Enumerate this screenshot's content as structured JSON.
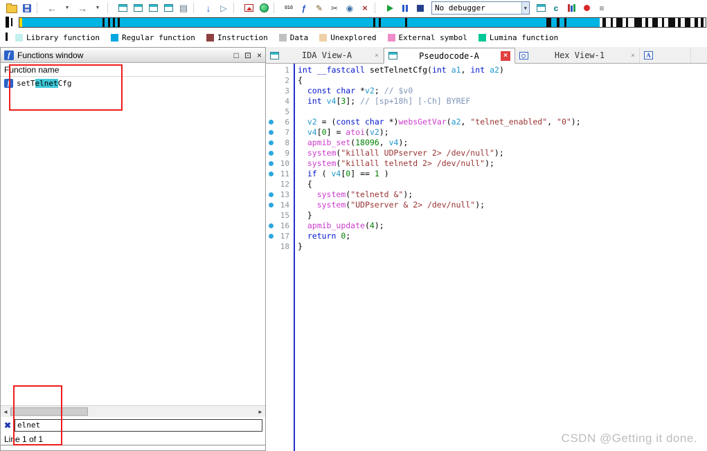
{
  "app": {
    "watermark": "CSDN @Getting it done."
  },
  "toolbar": {
    "debugger_combo": "No debugger",
    "items": [
      {
        "name": "open-file-icon",
        "kind": "folder"
      },
      {
        "name": "save-file-icon",
        "kind": "floppy"
      },
      {
        "name": "separator",
        "kind": "sep"
      },
      {
        "name": "navigate-back-icon",
        "kind": "glyph",
        "glyph": "←",
        "fg": "#6e6e6e",
        "size": 14,
        "bold": true
      },
      {
        "name": "back-history-dropdown-icon",
        "kind": "glyph",
        "glyph": "▼",
        "fg": "#505050",
        "size": 7
      },
      {
        "name": "navigate-forward-icon",
        "kind": "glyph",
        "glyph": "→",
        "fg": "#6e6e6e",
        "size": 14,
        "bold": true
      },
      {
        "name": "forward-history-dropdown-icon",
        "kind": "glyph",
        "glyph": "▼",
        "fg": "#505050",
        "size": 7
      },
      {
        "name": "separator",
        "kind": "sep"
      },
      {
        "name": "open-ida-view-icon",
        "kind": "win"
      },
      {
        "name": "open-hex-view-icon",
        "kind": "win"
      },
      {
        "name": "open-structures-icon",
        "kind": "win"
      },
      {
        "name": "open-enums-icon",
        "kind": "win"
      },
      {
        "name": "print-icon",
        "kind": "glyph",
        "glyph": "▤",
        "fg": "#5f7585",
        "size": 13
      },
      {
        "name": "separator",
        "kind": "sep"
      },
      {
        "name": "jump-address-icon",
        "kind": "glyph",
        "glyph": "↓",
        "fg": "#1d5fd6",
        "size": 14,
        "bold": true
      },
      {
        "name": "run-plugin-icon",
        "kind": "glyph",
        "glyph": "▷",
        "fg": "#4a7d9a",
        "size": 12
      },
      {
        "name": "separator",
        "kind": "sep"
      },
      {
        "name": "flow-chart-icon",
        "kind": "image"
      },
      {
        "name": "lumina-icon",
        "kind": "lumina"
      },
      {
        "name": "separator",
        "kind": "sep"
      },
      {
        "name": "binary-data-icon",
        "kind": "glyph",
        "glyph": "010",
        "fg": "#404040",
        "size": 7,
        "bold": true
      },
      {
        "name": "create-function-icon",
        "kind": "glyph",
        "glyph": "ƒ",
        "fg": "#2050c0",
        "size": 12,
        "bold": true
      },
      {
        "name": "edit-comment-icon",
        "kind": "glyph",
        "glyph": "✎",
        "fg": "#806030",
        "size": 12
      },
      {
        "name": "cut-patch-icon",
        "kind": "glyph",
        "glyph": "✂",
        "fg": "#505050",
        "size": 12
      },
      {
        "name": "snapshot-icon",
        "kind": "glyph",
        "glyph": "◉",
        "fg": "#3a6ea5",
        "size": 12
      },
      {
        "name": "delete-function-icon",
        "kind": "glyph",
        "glyph": "×",
        "fg": "#a03030",
        "size": 13,
        "bold": true
      },
      {
        "name": "separator",
        "kind": "sep"
      },
      {
        "name": "start-process-icon",
        "kind": "play"
      },
      {
        "name": "pause-process-icon",
        "kind": "pause"
      },
      {
        "name": "stop-process-icon",
        "kind": "stop"
      },
      {
        "name": "debugger-selector",
        "kind": "combo"
      },
      {
        "name": "attach-process-icon",
        "kind": "win"
      },
      {
        "name": "run-to-cursor-icon",
        "kind": "glyph",
        "glyph": "c",
        "fg": "#00787f",
        "size": 12,
        "bold": true
      },
      {
        "name": "open-libraries-icon",
        "kind": "books"
      },
      {
        "name": "breakpoint-icon",
        "kind": "bpt"
      },
      {
        "name": "debugger-options-icon",
        "kind": "glyph",
        "glyph": "≡",
        "fg": "#585858",
        "size": 12,
        "bold": true
      }
    ]
  },
  "navband": {
    "base_color": "#00b4e4",
    "segments": [
      {
        "pos": 0,
        "w": 0.45,
        "color": "#ffd800"
      },
      {
        "pos": 12.1,
        "w": 0.35,
        "color": "#101010"
      },
      {
        "pos": 12.9,
        "w": 0.35,
        "color": "#101010"
      },
      {
        "pos": 13.6,
        "w": 0.3,
        "color": "#101010"
      },
      {
        "pos": 14.3,
        "w": 0.3,
        "color": "#101010"
      },
      {
        "pos": 51.6,
        "w": 0.3,
        "color": "#101010"
      },
      {
        "pos": 52.4,
        "w": 0.3,
        "color": "#101010"
      },
      {
        "pos": 56.2,
        "w": 0.3,
        "color": "#101010"
      },
      {
        "pos": 76.8,
        "w": 0.7,
        "color": "#101010"
      },
      {
        "pos": 78.3,
        "w": 0.4,
        "color": "#101010"
      },
      {
        "pos": 79.4,
        "w": 0.3,
        "color": "#101010"
      },
      {
        "pos": 84.6,
        "w": 15.4,
        "color": "#f8f8f8"
      },
      {
        "pos": 85.0,
        "w": 0.5,
        "color": "#101010"
      },
      {
        "pos": 86.2,
        "w": 0.3,
        "color": "#101010"
      },
      {
        "pos": 87.0,
        "w": 0.9,
        "color": "#101010"
      },
      {
        "pos": 88.4,
        "w": 0.35,
        "color": "#101010"
      },
      {
        "pos": 89.6,
        "w": 1.1,
        "color": "#101010"
      },
      {
        "pos": 91.2,
        "w": 0.4,
        "color": "#101010"
      },
      {
        "pos": 92.2,
        "w": 0.8,
        "color": "#101010"
      },
      {
        "pos": 93.6,
        "w": 0.35,
        "color": "#101010"
      },
      {
        "pos": 94.6,
        "w": 1.0,
        "color": "#101010"
      },
      {
        "pos": 96.0,
        "w": 0.4,
        "color": "#101010"
      },
      {
        "pos": 97.0,
        "w": 0.8,
        "color": "#101010"
      },
      {
        "pos": 98.4,
        "w": 0.5,
        "color": "#101010"
      },
      {
        "pos": 99.3,
        "w": 0.4,
        "color": "#101010"
      }
    ]
  },
  "legend": {
    "items": [
      {
        "label": "Library function",
        "color": "#c4f0ee"
      },
      {
        "label": "Regular function",
        "color": "#00a8e0"
      },
      {
        "label": "Instruction",
        "color": "#8e4040"
      },
      {
        "label": "Data",
        "color": "#c0c0c0"
      },
      {
        "label": "Unexplored",
        "color": "#f0d0a8"
      },
      {
        "label": "External symbol",
        "color": "#f08cc8"
      },
      {
        "label": "Lumina function",
        "color": "#00c896"
      }
    ]
  },
  "functions_panel": {
    "title": "Functions window",
    "column_header": "Function name",
    "highlight_color": "#3fc8d8",
    "rows": [
      {
        "name_segments": [
          {
            "t": "setT"
          },
          {
            "t": "elnet",
            "hl": true
          },
          {
            "t": "Cfg"
          }
        ]
      }
    ],
    "search_value": "elnet",
    "status": "Line 1 of 1"
  },
  "tab_bar": {
    "tabs": [
      {
        "name": "tab-ida-view-a",
        "label": "IDA View-A",
        "icon": "ida-view-icon",
        "kind": "win",
        "active": false,
        "close": "gray"
      },
      {
        "name": "tab-pseudocode-a",
        "label": "Pseudocode-A",
        "icon": "pseudocode-icon",
        "kind": "win",
        "active": true,
        "close": "red"
      },
      {
        "name": "tab-hex-view-1",
        "label": "Hex View-1",
        "icon": "hex-view-icon",
        "kind": "hexwin",
        "active": false,
        "close": "gray"
      },
      {
        "name": "tab-strings",
        "label": "",
        "icon": "strings-view-icon",
        "kind": "awin",
        "letter": "A",
        "active": false,
        "close": "none"
      }
    ]
  },
  "pseudocode": {
    "dot_color": "#2da7dc",
    "syntax_colors": {
      "kw": "#0014cc",
      "fn": "#000000",
      "var": "#2097ce",
      "lib": "#cc3ccc",
      "str": "#993333",
      "num": "#008000",
      "cmt": "#8095b8",
      "pl": "#000000"
    },
    "lines": [
      {
        "n": 1,
        "dot": false,
        "seg": [
          [
            "kw",
            "int"
          ],
          [
            "pl",
            " "
          ],
          [
            "kw",
            "__fastcall"
          ],
          [
            "pl",
            " "
          ],
          [
            "fn",
            "setTelnetCfg"
          ],
          [
            "pl",
            "("
          ],
          [
            "kw",
            "int"
          ],
          [
            "pl",
            " "
          ],
          [
            "var",
            "a1"
          ],
          [
            "pl",
            ", "
          ],
          [
            "kw",
            "int"
          ],
          [
            "pl",
            " "
          ],
          [
            "var",
            "a2"
          ],
          [
            "pl",
            ")"
          ]
        ]
      },
      {
        "n": 2,
        "dot": false,
        "seg": [
          [
            "pl",
            "{"
          ]
        ]
      },
      {
        "n": 3,
        "dot": false,
        "seg": [
          [
            "pl",
            "  "
          ],
          [
            "kw",
            "const"
          ],
          [
            "pl",
            " "
          ],
          [
            "kw",
            "char"
          ],
          [
            "pl",
            " *"
          ],
          [
            "var",
            "v2"
          ],
          [
            "pl",
            "; "
          ],
          [
            "cmt",
            "// $v0"
          ]
        ]
      },
      {
        "n": 4,
        "dot": false,
        "seg": [
          [
            "pl",
            "  "
          ],
          [
            "kw",
            "int"
          ],
          [
            "pl",
            " "
          ],
          [
            "var",
            "v4"
          ],
          [
            "pl",
            "["
          ],
          [
            "num",
            "3"
          ],
          [
            "pl",
            "]; "
          ],
          [
            "cmt",
            "// [sp+18h] [-Ch] BYREF"
          ]
        ]
      },
      {
        "n": 5,
        "dot": false,
        "seg": []
      },
      {
        "n": 6,
        "dot": true,
        "seg": [
          [
            "pl",
            "  "
          ],
          [
            "var",
            "v2"
          ],
          [
            "pl",
            " = ("
          ],
          [
            "kw",
            "const"
          ],
          [
            "pl",
            " "
          ],
          [
            "kw",
            "char"
          ],
          [
            "pl",
            " *)"
          ],
          [
            "lib",
            "websGetVar"
          ],
          [
            "pl",
            "("
          ],
          [
            "var",
            "a2"
          ],
          [
            "pl",
            ", "
          ],
          [
            "str",
            "\"telnet_enabled\""
          ],
          [
            "pl",
            ", "
          ],
          [
            "str",
            "\"0\""
          ],
          [
            "pl",
            ");"
          ]
        ]
      },
      {
        "n": 7,
        "dot": true,
        "seg": [
          [
            "pl",
            "  "
          ],
          [
            "var",
            "v4"
          ],
          [
            "pl",
            "["
          ],
          [
            "num",
            "0"
          ],
          [
            "pl",
            "] = "
          ],
          [
            "lib",
            "atoi"
          ],
          [
            "pl",
            "("
          ],
          [
            "var",
            "v2"
          ],
          [
            "pl",
            ");"
          ]
        ]
      },
      {
        "n": 8,
        "dot": true,
        "seg": [
          [
            "pl",
            "  "
          ],
          [
            "lib",
            "apmib_set"
          ],
          [
            "pl",
            "("
          ],
          [
            "num",
            "18096"
          ],
          [
            "pl",
            ", "
          ],
          [
            "var",
            "v4"
          ],
          [
            "pl",
            ");"
          ]
        ]
      },
      {
        "n": 9,
        "dot": true,
        "seg": [
          [
            "pl",
            "  "
          ],
          [
            "lib",
            "system"
          ],
          [
            "pl",
            "("
          ],
          [
            "str",
            "\"killall UDPserver 2> /dev/null\""
          ],
          [
            "pl",
            ");"
          ]
        ]
      },
      {
        "n": 10,
        "dot": true,
        "seg": [
          [
            "pl",
            "  "
          ],
          [
            "lib",
            "system"
          ],
          [
            "pl",
            "("
          ],
          [
            "str",
            "\"killall telnetd 2> /dev/null\""
          ],
          [
            "pl",
            ");"
          ]
        ]
      },
      {
        "n": 11,
        "dot": true,
        "seg": [
          [
            "pl",
            "  "
          ],
          [
            "kw",
            "if"
          ],
          [
            "pl",
            " ( "
          ],
          [
            "var",
            "v4"
          ],
          [
            "pl",
            "["
          ],
          [
            "num",
            "0"
          ],
          [
            "pl",
            "] == "
          ],
          [
            "num",
            "1"
          ],
          [
            "pl",
            " )"
          ]
        ]
      },
      {
        "n": 12,
        "dot": false,
        "seg": [
          [
            "pl",
            "  {"
          ]
        ]
      },
      {
        "n": 13,
        "dot": true,
        "seg": [
          [
            "pl",
            "    "
          ],
          [
            "lib",
            "system"
          ],
          [
            "pl",
            "("
          ],
          [
            "str",
            "\"telnetd &\""
          ],
          [
            "pl",
            ");"
          ]
        ]
      },
      {
        "n": 14,
        "dot": true,
        "seg": [
          [
            "pl",
            "    "
          ],
          [
            "lib",
            "system"
          ],
          [
            "pl",
            "("
          ],
          [
            "str",
            "\"UDPserver & 2> /dev/null\""
          ],
          [
            "pl",
            ");"
          ]
        ]
      },
      {
        "n": 15,
        "dot": false,
        "seg": [
          [
            "pl",
            "  }"
          ]
        ]
      },
      {
        "n": 16,
        "dot": true,
        "seg": [
          [
            "pl",
            "  "
          ],
          [
            "lib",
            "apmib_update"
          ],
          [
            "pl",
            "("
          ],
          [
            "num",
            "4"
          ],
          [
            "pl",
            ");"
          ]
        ]
      },
      {
        "n": 17,
        "dot": true,
        "seg": [
          [
            "pl",
            "  "
          ],
          [
            "kw",
            "return"
          ],
          [
            "pl",
            " "
          ],
          [
            "num",
            "0"
          ],
          [
            "pl",
            ";"
          ]
        ]
      },
      {
        "n": 18,
        "dot": false,
        "seg": [
          [
            "pl",
            "}"
          ]
        ]
      }
    ]
  }
}
